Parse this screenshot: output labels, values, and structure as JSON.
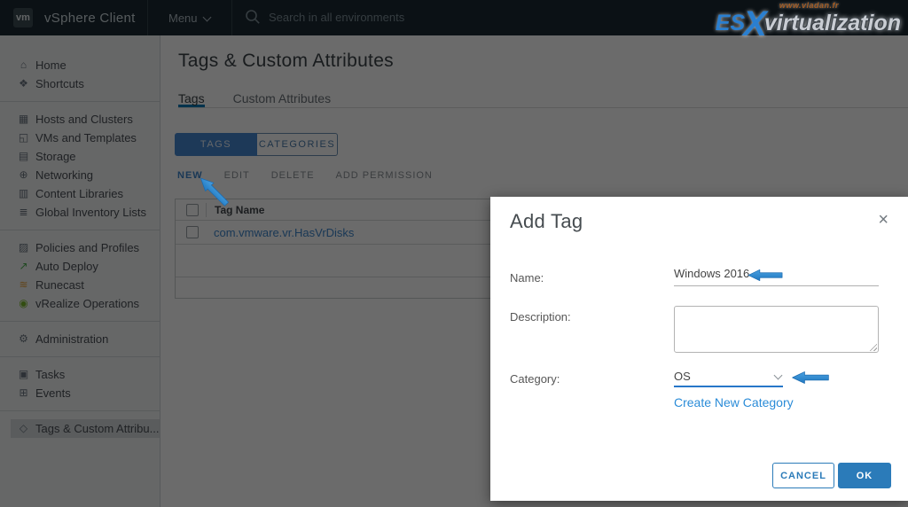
{
  "topnav": {
    "logo": "vm",
    "app_title": "vSphere Client",
    "menu_label": "Menu",
    "search_placeholder": "Search in all environments"
  },
  "watermark": {
    "url_text": "www.vladan.fr",
    "part1": "ES",
    "part2": "X",
    "part3": "virtualization"
  },
  "sidebar": {
    "groups": [
      {
        "items": [
          {
            "label": "Home",
            "icon": "home-icon",
            "glyph": "⌂"
          },
          {
            "label": "Shortcuts",
            "icon": "shortcuts-icon",
            "glyph": "❖"
          }
        ]
      },
      {
        "items": [
          {
            "label": "Hosts and Clusters",
            "icon": "hosts-and-clusters-icon",
            "glyph": "▦"
          },
          {
            "label": "VMs and Templates",
            "icon": "vms-and-templates-icon",
            "glyph": "◱"
          },
          {
            "label": "Storage",
            "icon": "storage-icon",
            "glyph": "▤"
          },
          {
            "label": "Networking",
            "icon": "networking-icon",
            "glyph": "⊕"
          },
          {
            "label": "Content Libraries",
            "icon": "content-libraries-icon",
            "glyph": "▥"
          },
          {
            "label": "Global Inventory Lists",
            "icon": "global-inventory-lists-icon",
            "glyph": "≣"
          }
        ]
      },
      {
        "items": [
          {
            "label": "Policies and Profiles",
            "icon": "policies-and-profiles-icon",
            "glyph": "▨"
          },
          {
            "label": "Auto Deploy",
            "icon": "auto-deploy-icon",
            "glyph": "↗"
          },
          {
            "label": "Runecast",
            "icon": "runecast-icon",
            "glyph": "≋"
          },
          {
            "label": "vRealize Operations",
            "icon": "vrealize-operations-icon",
            "glyph": "◉"
          }
        ]
      },
      {
        "items": [
          {
            "label": "Administration",
            "icon": "administration-icon",
            "glyph": "⚙"
          }
        ]
      },
      {
        "items": [
          {
            "label": "Tasks",
            "icon": "tasks-icon",
            "glyph": "▣"
          },
          {
            "label": "Events",
            "icon": "events-icon",
            "glyph": "⊞"
          }
        ]
      },
      {
        "items": [
          {
            "label": "Tags & Custom Attribu...",
            "icon": "tag-icon",
            "glyph": "◇",
            "selected": true
          }
        ]
      }
    ]
  },
  "main": {
    "page_title": "Tags & Custom Attributes",
    "tabs": [
      {
        "label": "Tags",
        "active": true
      },
      {
        "label": "Custom Attributes",
        "active": false
      }
    ],
    "toggle": [
      {
        "label": "TAGS",
        "active": true
      },
      {
        "label": "CATEGORIES",
        "active": false
      }
    ],
    "actions": [
      {
        "label": "NEW",
        "enabled": true
      },
      {
        "label": "EDIT",
        "enabled": false
      },
      {
        "label": "DELETE",
        "enabled": false
      },
      {
        "label": "ADD PERMISSION",
        "enabled": false
      }
    ],
    "table": {
      "columns": [
        "Tag Name"
      ],
      "rows": [
        {
          "name": "com.vmware.vr.HasVrDisks"
        }
      ]
    }
  },
  "modal": {
    "title": "Add Tag",
    "close_glyph": "×",
    "name_label": "Name:",
    "name_value": "Windows 2016",
    "description_label": "Description:",
    "description_value": "",
    "category_label": "Category:",
    "category_value": "OS",
    "create_link": "Create New Category",
    "cancel_label": "CANCEL",
    "ok_label": "OK"
  },
  "colors": {
    "header_bg": "#1b2a32",
    "accent": "#0079b8",
    "primary_button": "#2b7bb9",
    "annotation_arrow": "#2f8ad2"
  }
}
